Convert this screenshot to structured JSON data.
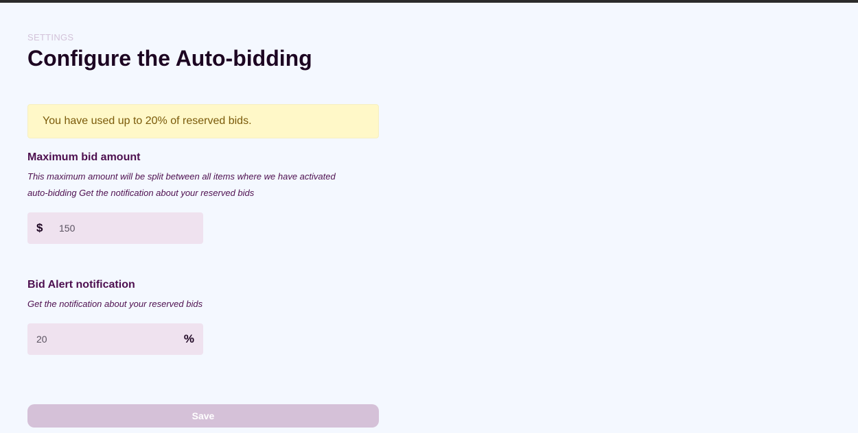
{
  "header": {
    "eyebrow": "SETTINGS",
    "title": "Configure the Auto-bidding"
  },
  "alert": {
    "text": "You have used up to 20% of reserved bids."
  },
  "max_bid": {
    "title": "Maximum bid amount",
    "description": "This maximum amount will be split between all items where we have activated auto-bidding Get the notification about your reserved bids",
    "prefix": "$",
    "value": "150"
  },
  "bid_alert": {
    "title": "Bid Alert notification",
    "description": "Get the notification about your reserved bids",
    "suffix": "%",
    "value": "20"
  },
  "actions": {
    "save_label": "Save"
  },
  "colors": {
    "background": "#f4f8ff",
    "title": "#1d0522",
    "accent": "#4d0f4f",
    "alert_bg": "#fff8c8",
    "alert_text": "#7a5a0a",
    "input_bg": "#efe2ef",
    "button_bg": "#d5c1d8"
  }
}
